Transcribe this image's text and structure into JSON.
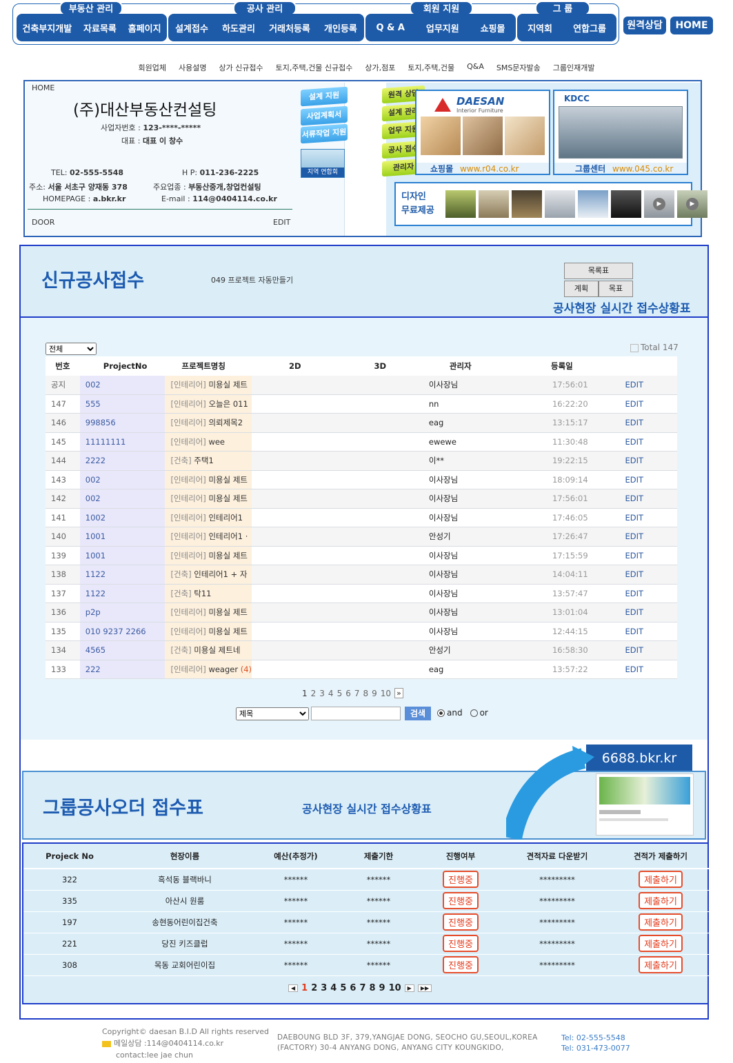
{
  "nav": {
    "groups": [
      {
        "caption": "부동산 관리",
        "items": [
          "건축부지개발",
          "자료목록",
          "홈페이지"
        ]
      },
      {
        "caption": "공사 관리",
        "items": [
          "설계접수",
          "하도관리",
          "거래처등록",
          "개인등록"
        ]
      },
      {
        "caption": "회원 지원",
        "items": [
          "Q & A",
          "업무지원",
          "쇼핑몰"
        ]
      },
      {
        "caption": "그 룹",
        "items": [
          "지역회",
          "연합그룹"
        ]
      }
    ],
    "remote_btn": "원격상담",
    "home_btn": "HOME"
  },
  "sublinks": [
    "회원업체",
    "사용설명",
    "상가 신규접수",
    "토지,주택,건물 신규접수",
    "상가,점포",
    "토지,주택,건물",
    "Q&A",
    "SMS문자발송",
    "그룹인재개발"
  ],
  "company": {
    "home": "HOME",
    "name": "(주)대산부동산컨설팅",
    "biz_label": "사업자번호 :",
    "biz_no": "123-****-*****",
    "ceo_label": "대표 :",
    "ceo": "대표 이 창수",
    "tel_label": "TEL:",
    "tel": "02-555-5548",
    "hp_label": "H P:",
    "hp": "011-236-2225",
    "addr_label": "주소:",
    "addr": "서울 서초구 양재동 378",
    "job_label": "주요업종 :",
    "job": "부동산중개,창업컨설팅",
    "homepage_label": "HOMEPAGE :",
    "homepage": "a.bkr.kr",
    "email_label": "E-mail :",
    "email": "114@0404114.co.kr",
    "door": "DOOR",
    "edit": "EDIT",
    "side_tags": [
      "설계 지원",
      "사업계획서",
      "서류작업 지원"
    ],
    "region_caption": "지역 연합회"
  },
  "rpanel": {
    "tags": [
      "원격 상담",
      "설계 관리",
      "업무 지원",
      "공사 접수",
      "관리자"
    ],
    "shop_brand": "DAESAN",
    "shop_sub": "Interior Furniture",
    "shop_caption": "쇼핑몰",
    "shop_url": "www.r04.co.kr",
    "group_brand": "KDCC",
    "group_caption": "그룹센터",
    "group_url": "www.045.co.kr",
    "design_line1": "디자인",
    "design_line2": "무료제공"
  },
  "section1": {
    "title": "신규공사접수",
    "subtitle": "049 프로젝트 자동만들기",
    "btn_list": "목록표",
    "btn_plan": "계획",
    "btn_goal": "목표",
    "realtime": "공사현장 실시간 접수상황표"
  },
  "list": {
    "filter": "전체",
    "total": "Total 147",
    "headers": [
      "번호",
      "ProjectNo",
      "프로젝트명칭",
      "2D",
      "3D",
      "관리자",
      "등록일",
      ""
    ],
    "rows": [
      {
        "no": "공지",
        "pn": "002",
        "cat": "[인테리어]",
        "name": "미용실 제트",
        "mgr": "이사장님",
        "time": "17:56:01",
        "edit": "EDIT"
      },
      {
        "no": "147",
        "pn": "555",
        "cat": "[인테리어]",
        "name": "오늘은 011",
        "mgr": "nn",
        "time": "16:22:20",
        "edit": "EDIT"
      },
      {
        "no": "146",
        "pn": "998856",
        "cat": "[인테리어]",
        "name": "의뢰제목2",
        "mgr": "eag",
        "time": "13:15:17",
        "edit": "EDIT"
      },
      {
        "no": "145",
        "pn": "11111111",
        "cat": "[인테리어]",
        "name": "wee",
        "mgr": "ewewe",
        "time": "11:30:48",
        "edit": "EDIT"
      },
      {
        "no": "144",
        "pn": "2222",
        "cat": "[건축]",
        "name": "주택1",
        "mgr": "이**",
        "time": "19:22:15",
        "edit": "EDIT"
      },
      {
        "no": "143",
        "pn": "002",
        "cat": "[인테리어]",
        "name": "미용실 제트",
        "mgr": "이사장님",
        "time": "18:09:14",
        "edit": "EDIT"
      },
      {
        "no": "142",
        "pn": "002",
        "cat": "[인테리어]",
        "name": "미용실 제트",
        "mgr": "이사장님",
        "time": "17:56:01",
        "edit": "EDIT"
      },
      {
        "no": "141",
        "pn": "1002",
        "cat": "[인테리어]",
        "name": "인테리어1",
        "mgr": "이사장님",
        "time": "17:46:05",
        "edit": "EDIT"
      },
      {
        "no": "140",
        "pn": "1001",
        "cat": "[인테리어]",
        "name": "인테리어1 ·",
        "mgr": "안성기",
        "time": "17:26:47",
        "edit": "EDIT"
      },
      {
        "no": "139",
        "pn": "1001",
        "cat": "[인테리어]",
        "name": "미용실 제트",
        "mgr": "이사장님",
        "time": "17:15:59",
        "edit": "EDIT"
      },
      {
        "no": "138",
        "pn": "1122",
        "cat": "[건축]",
        "name": "인테리어1 + 자",
        "mgr": "이사장님",
        "time": "14:04:11",
        "edit": "EDIT"
      },
      {
        "no": "137",
        "pn": "1122",
        "cat": "[건축]",
        "name": "탁11",
        "mgr": "이사장님",
        "time": "13:57:47",
        "edit": "EDIT"
      },
      {
        "no": "136",
        "pn": "p2p",
        "cat": "[인테리어]",
        "name": "미용실 제트",
        "mgr": "이사장님",
        "time": "13:01:04",
        "edit": "EDIT"
      },
      {
        "no": "135",
        "pn": "010 9237 2266",
        "cat": "[인테리어]",
        "name": "미용실 제트",
        "mgr": "이사장님",
        "time": "12:44:15",
        "edit": "EDIT"
      },
      {
        "no": "134",
        "pn": "4565",
        "cat": "[건축]",
        "name": "미용실 제트네",
        "mgr": "안성기",
        "time": "16:58:30",
        "edit": "EDIT"
      },
      {
        "no": "133",
        "pn": "222",
        "cat": "[인테리어]",
        "name": "weager",
        "count": "(4)",
        "mgr": "eag",
        "time": "13:57:22",
        "edit": "EDIT"
      }
    ],
    "pages": [
      "1",
      "2",
      "3",
      "4",
      "5",
      "6",
      "7",
      "8",
      "9",
      "10"
    ],
    "next": "»",
    "search_field": "제목",
    "search_btn": "검색",
    "and_label": "and",
    "or_label": "or"
  },
  "section2": {
    "url_badge": "6688.bkr.kr",
    "title": "그룹공사오더 접수표",
    "realtime": "공사현장 실시간 접수상황표",
    "headers": [
      "Projeck No",
      "현장이름",
      "예산(추정가)",
      "제출기한",
      "진행여부",
      "견적자료 다운받기",
      "견적가 제출하기"
    ],
    "rows": [
      {
        "no": "322",
        "site": "흑석동 블랙바니",
        "budget": "******",
        "deadline": "******",
        "status": "진행중",
        "download": "*********",
        "submit": "제출하기"
      },
      {
        "no": "335",
        "site": "아산시 원룸",
        "budget": "******",
        "deadline": "******",
        "status": "진행중",
        "download": "*********",
        "submit": "제출하기"
      },
      {
        "no": "197",
        "site": "송현동어린이집건축",
        "budget": "******",
        "deadline": "******",
        "status": "진행중",
        "download": "*********",
        "submit": "제출하기"
      },
      {
        "no": "221",
        "site": "당진 키즈클럽",
        "budget": "******",
        "deadline": "******",
        "status": "진행중",
        "download": "*********",
        "submit": "제출하기"
      },
      {
        "no": "308",
        "site": "목동 교회어린이집",
        "budget": "******",
        "deadline": "******",
        "status": "진행중",
        "download": "*********",
        "submit": "제출하기"
      }
    ],
    "pages": [
      "1",
      "2",
      "3",
      "4",
      "5",
      "6",
      "7",
      "8",
      "9",
      "10"
    ]
  },
  "footer": {
    "copyright": "Copyright© daesan B.I.D All rights reserved",
    "mail": "메일상담 :114@0404114.co.kr",
    "contact": "contact:lee jae chun",
    "addr1": "DAEBOUNG BLD 3F, 379,YANGJAE DONG, SEOCHO GU,SEOUL,KOREA",
    "addr2": "(FACTORY) 30-4 ANYANG DONG, ANYANG CITY KOUNGKIDO,",
    "tel1": "Tel: 02-555-5548",
    "tel2": "Tel: 031-473-0077"
  },
  "colors": {
    "nav_blue": "#1d5aa8",
    "title_blue": "#1d5bb0",
    "panel_bg": "#dbeef8",
    "status_red": "#e23a1b"
  }
}
